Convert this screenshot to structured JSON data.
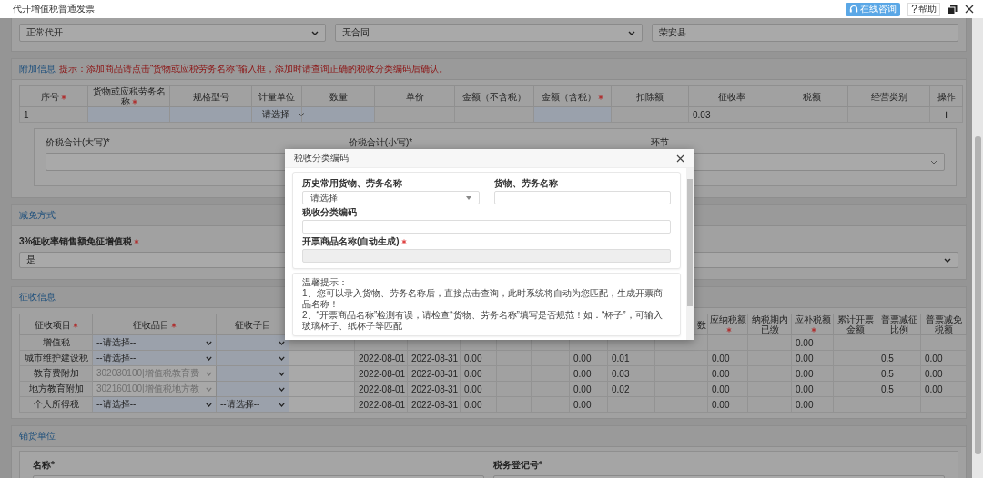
{
  "window": {
    "title": "代开增值税普通发票",
    "consult_button": "在线咨询",
    "help_glyph": "?",
    "help_button": "帮助"
  },
  "top_fields": [
    {
      "kind": "select",
      "value": "正常代开"
    },
    {
      "kind": "select",
      "value": "无合同"
    },
    {
      "kind": "field",
      "value": "荣安县"
    }
  ],
  "additional": {
    "title": "附加信息",
    "tip": "提示：添加商品请点击“货物或应税劳务名称”输入框，添加时请查询正确的税收分类编码后确认。",
    "columns": [
      {
        "label": "序号",
        "required": true
      },
      {
        "label": "货物或应税劳务名称",
        "required": true
      },
      {
        "label": "规格型号",
        "required": false
      },
      {
        "label": "计量单位",
        "required": false
      },
      {
        "label": "数量",
        "required": false
      },
      {
        "label": "单价",
        "required": false
      },
      {
        "label": "金额（不含税）",
        "required": false
      },
      {
        "label": "金额（含税）",
        "required": true
      },
      {
        "label": "扣除额",
        "required": false
      },
      {
        "label": "征收率",
        "required": false
      },
      {
        "label": "税额",
        "required": false
      },
      {
        "label": "经营类别",
        "required": false
      },
      {
        "label": "操作",
        "required": false
      }
    ],
    "rows": [
      {
        "cells": [
          {
            "kind": "text",
            "value": "1"
          },
          {
            "kind": "input"
          },
          {
            "kind": "input"
          },
          {
            "kind": "select",
            "value": "--请选择--"
          },
          {
            "kind": "input"
          },
          {
            "kind": "empty"
          },
          {
            "kind": "empty"
          },
          {
            "kind": "input"
          },
          {
            "kind": "empty"
          },
          {
            "kind": "text",
            "value": "0.03"
          },
          {
            "kind": "empty"
          },
          {
            "kind": "empty"
          },
          {
            "kind": "action",
            "value": "+"
          }
        ]
      }
    ],
    "totals": [
      {
        "label": "价税合计(大写)*",
        "kind": "field"
      },
      {
        "label": "价税合计(小写)*",
        "kind": "field"
      },
      {
        "label": "环节",
        "kind": "select"
      }
    ]
  },
  "reduction": {
    "title": "减免方式",
    "label": "3%征收率销售额免征增值税",
    "required": true,
    "value": "是"
  },
  "levy": {
    "title": "征收信息",
    "columns": [
      {
        "label": "征收项目",
        "required": true
      },
      {
        "label": "征收品目",
        "required": true
      },
      {
        "label": "征收子目",
        "required": false
      },
      {},
      {},
      {},
      {},
      {},
      {},
      {},
      {},
      {
        "label": "数",
        "required": false
      },
      {
        "label": "应纳税额",
        "required": true
      },
      {
        "label": "纳税期内已缴",
        "required": false
      },
      {
        "label": "应补税额",
        "required": true
      },
      {
        "label": "累计开票金额",
        "required": false
      },
      {
        "label": "普票减征比例",
        "required": false
      },
      {
        "label": "普票减免税额",
        "required": false
      }
    ],
    "rows": [
      {
        "cells": [
          {
            "kind": "text",
            "value": "增值税"
          },
          {
            "kind": "select",
            "value": "--请选择--"
          },
          {
            "kind": "select"
          },
          {
            "kind": "empty"
          },
          {
            "kind": "empty"
          },
          {
            "kind": "empty"
          },
          {
            "kind": "empty"
          },
          {
            "kind": "empty"
          },
          {
            "kind": "empty"
          },
          {
            "kind": "empty"
          },
          {
            "kind": "empty"
          },
          {
            "kind": "empty"
          },
          {
            "kind": "empty"
          },
          {
            "kind": "empty"
          },
          {
            "kind": "text",
            "value": "0.00"
          },
          {
            "kind": "empty"
          },
          {
            "kind": "empty"
          },
          {
            "kind": "empty"
          }
        ]
      },
      {
        "cells": [
          {
            "kind": "text",
            "value": "城市维护建设税"
          },
          {
            "kind": "select",
            "value": "--请选择--"
          },
          {
            "kind": "select"
          },
          {
            "kind": "block"
          },
          {
            "kind": "text",
            "value": "2022-08-01"
          },
          {
            "kind": "text",
            "value": "2022-08-31"
          },
          {
            "kind": "text",
            "value": "0.00"
          },
          {
            "kind": "empty"
          },
          {
            "kind": "empty"
          },
          {
            "kind": "text",
            "value": "0.00"
          },
          {
            "kind": "text",
            "value": "0.01"
          },
          {
            "kind": "empty"
          },
          {
            "kind": "text",
            "value": "0.00"
          },
          {
            "kind": "empty"
          },
          {
            "kind": "text",
            "value": "0.00"
          },
          {
            "kind": "empty"
          },
          {
            "kind": "text",
            "value": "0.5"
          },
          {
            "kind": "text",
            "value": "0.00"
          }
        ]
      },
      {
        "cells": [
          {
            "kind": "text",
            "value": "教育费附加"
          },
          {
            "kind": "disabled",
            "value": "302030100|增值税教育费"
          },
          {
            "kind": "select"
          },
          {
            "kind": "block"
          },
          {
            "kind": "text",
            "value": "2022-08-01"
          },
          {
            "kind": "text",
            "value": "2022-08-31"
          },
          {
            "kind": "text",
            "value": "0.00"
          },
          {
            "kind": "empty"
          },
          {
            "kind": "empty"
          },
          {
            "kind": "text",
            "value": "0.00"
          },
          {
            "kind": "text",
            "value": "0.03"
          },
          {
            "kind": "empty"
          },
          {
            "kind": "text",
            "value": "0.00"
          },
          {
            "kind": "empty"
          },
          {
            "kind": "text",
            "value": "0.00"
          },
          {
            "kind": "empty"
          },
          {
            "kind": "text",
            "value": "0.5"
          },
          {
            "kind": "text",
            "value": "0.00"
          }
        ]
      },
      {
        "cells": [
          {
            "kind": "text",
            "value": "地方教育附加"
          },
          {
            "kind": "disabled",
            "value": "302160100|增值税地方教"
          },
          {
            "kind": "select"
          },
          {
            "kind": "block"
          },
          {
            "kind": "text",
            "value": "2022-08-01"
          },
          {
            "kind": "text",
            "value": "2022-08-31"
          },
          {
            "kind": "text",
            "value": "0.00"
          },
          {
            "kind": "empty"
          },
          {
            "kind": "empty"
          },
          {
            "kind": "text",
            "value": "0.00"
          },
          {
            "kind": "text",
            "value": "0.02"
          },
          {
            "kind": "empty"
          },
          {
            "kind": "text",
            "value": "0.00"
          },
          {
            "kind": "empty"
          },
          {
            "kind": "text",
            "value": "0.00"
          },
          {
            "kind": "empty"
          },
          {
            "kind": "text",
            "value": "0.5"
          },
          {
            "kind": "text",
            "value": "0.00"
          }
        ]
      },
      {
        "cells": [
          {
            "kind": "text",
            "value": "个人所得税"
          },
          {
            "kind": "select",
            "value": "--请选择--"
          },
          {
            "kind": "select",
            "value": "--请选择--"
          },
          {
            "kind": "block"
          },
          {
            "kind": "text",
            "value": "2022-08-01"
          },
          {
            "kind": "text",
            "value": "2022-08-31"
          },
          {
            "kind": "text",
            "value": "0.00"
          },
          {
            "kind": "empty"
          },
          {
            "kind": "empty"
          },
          {
            "kind": "text",
            "value": "0.00"
          },
          {
            "kind": "empty"
          },
          {
            "kind": "empty"
          },
          {
            "kind": "text",
            "value": "0.00"
          },
          {
            "kind": "empty"
          },
          {
            "kind": "text",
            "value": "0.00"
          },
          {
            "kind": "empty"
          },
          {
            "kind": "empty"
          },
          {
            "kind": "empty"
          }
        ]
      }
    ]
  },
  "seller": {
    "title": "销货单位",
    "fields": [
      {
        "label": "名称*"
      },
      {
        "label": "税务登记号*"
      }
    ]
  },
  "dialog": {
    "title": "税收分类编码",
    "fields": [
      {
        "label": "历史常用货物、劳务名称",
        "required": false,
        "kind": "select",
        "value": "请选择"
      },
      {
        "label": "货物、劳务名称",
        "required": false,
        "kind": "input"
      },
      {
        "label": "税收分类编码",
        "required": false,
        "kind": "input"
      },
      {
        "label": "开票商品名称(自动生成)",
        "required": true,
        "kind": "disabled"
      }
    ],
    "tip_title": "温馨提示：",
    "tips": [
      "1、您可以录入货物、劳务名称后，直接点击查询，此时系统将自动为您匹配，生成开票商品名称！",
      "2、“开票商品名称”检测有误，请检查“货物、劳务名称”填写是否规范！如：“杯子”，可输入玻璃杯子、纸杯子等匹配"
    ]
  }
}
